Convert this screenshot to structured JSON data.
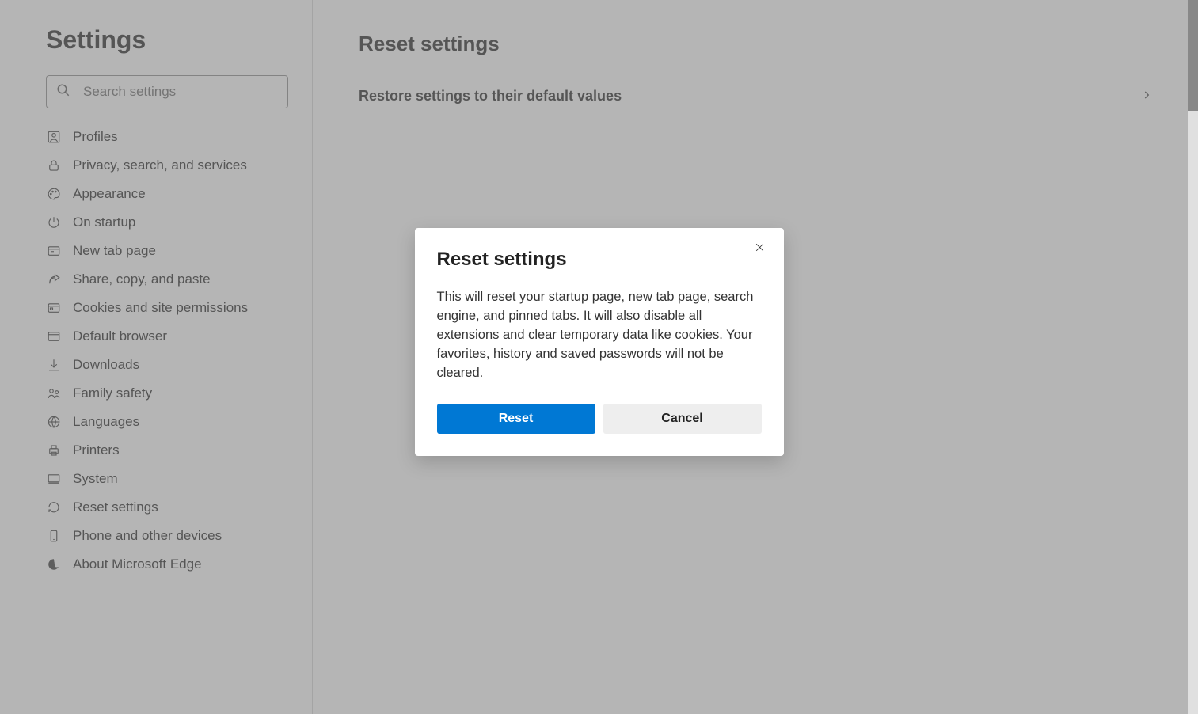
{
  "sidebar": {
    "title": "Settings",
    "search_placeholder": "Search settings",
    "items": [
      {
        "label": "Profiles"
      },
      {
        "label": "Privacy, search, and services"
      },
      {
        "label": "Appearance"
      },
      {
        "label": "On startup"
      },
      {
        "label": "New tab page"
      },
      {
        "label": "Share, copy, and paste"
      },
      {
        "label": "Cookies and site permissions"
      },
      {
        "label": "Default browser"
      },
      {
        "label": "Downloads"
      },
      {
        "label": "Family safety"
      },
      {
        "label": "Languages"
      },
      {
        "label": "Printers"
      },
      {
        "label": "System"
      },
      {
        "label": "Reset settings"
      },
      {
        "label": "Phone and other devices"
      },
      {
        "label": "About Microsoft Edge"
      }
    ]
  },
  "main": {
    "title": "Reset settings",
    "restore_label": "Restore settings to their default values"
  },
  "dialog": {
    "title": "Reset settings",
    "body": "This will reset your startup page, new tab page, search engine, and pinned tabs. It will also disable all extensions and clear temporary data like cookies. Your favorites, history and saved passwords will not be cleared.",
    "reset_label": "Reset",
    "cancel_label": "Cancel"
  }
}
